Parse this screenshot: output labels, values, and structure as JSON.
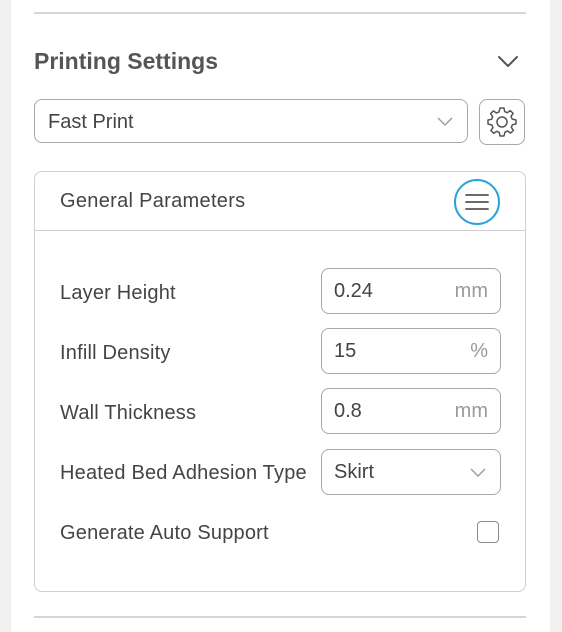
{
  "section": {
    "title": "Printing Settings",
    "collapse_icon": "chevron-down-icon"
  },
  "profile": {
    "selected": "Fast Print",
    "dropdown_icon": "chevron-down-icon",
    "settings_icon": "gear-icon"
  },
  "general_parameters": {
    "title": "General Parameters",
    "menu_icon": "hamburger-menu-icon",
    "accent_color": "#2aa3dc",
    "layer_height": {
      "label": "Layer Height",
      "value": "0.24",
      "unit": "mm"
    },
    "infill_density": {
      "label": "Infill Density",
      "value": "15",
      "unit": "%"
    },
    "wall_thickness": {
      "label": "Wall Thickness",
      "value": "0.8",
      "unit": "mm"
    },
    "adhesion_type": {
      "label": "Heated Bed Adhesion Type",
      "selected": "Skirt"
    },
    "auto_support": {
      "label": "Generate Auto Support",
      "checked": false
    }
  }
}
